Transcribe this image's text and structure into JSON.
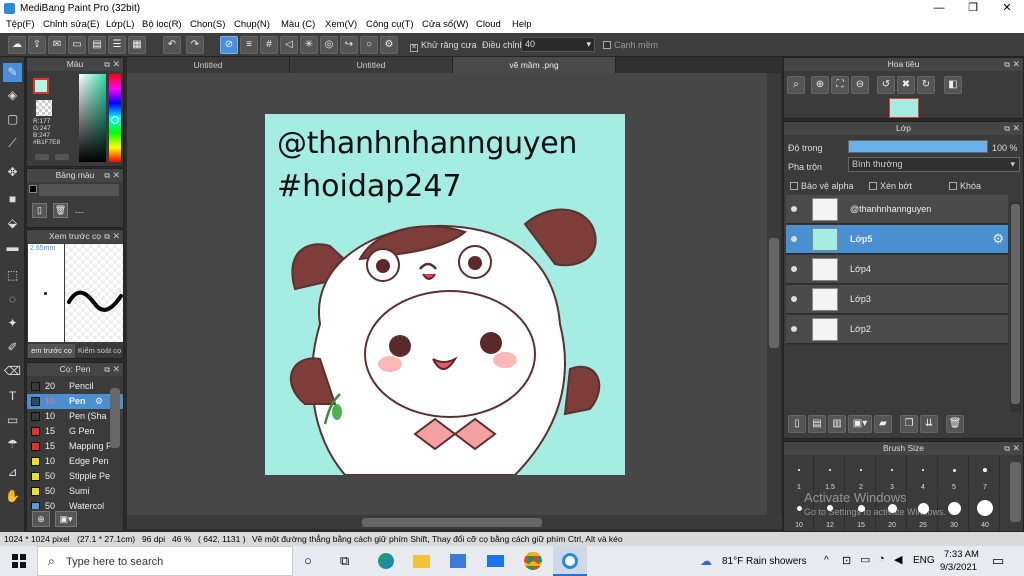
{
  "app": {
    "title": "MediBang Paint Pro (32bit)"
  },
  "menu": [
    "Tệp(F)",
    "Chỉnh sửa(E)",
    "Lớp(L)",
    "Bộ lọc(R)",
    "Chọn(S)",
    "Chụp(N)",
    "Màu (C)",
    "Xem(V)",
    "Công cụ(T)",
    "Cửa sổ(W)",
    "Cloud",
    "Help"
  ],
  "toolbar": {
    "antialias": "Khử răng cưa",
    "correction": "Điều chỉnh",
    "correction_value": "40",
    "edge": "Cạnh mềm"
  },
  "color_panel": {
    "title": "Màu",
    "r": "R:177",
    "g": "G:247",
    "b": "B:247",
    "hex": "#B1F7E8"
  },
  "palette_panel": {
    "title": "Bảng màu",
    "placeholder": "---"
  },
  "preview_panel": {
    "title": "Xem trước cọ",
    "size": "2.65mm",
    "tab1": "em trước cọ",
    "tab2": "Kiểm soát cọ"
  },
  "brush_panel": {
    "title": "Cọ: Pen",
    "items": [
      {
        "size": "20",
        "name": "Pencil",
        "color": "#3a3a3a"
      },
      {
        "size": "10",
        "name": "Pen",
        "color": "#2b4b6b",
        "selected": true
      },
      {
        "size": "10",
        "name": "Pen (Sha",
        "color": "#3a3a3a"
      },
      {
        "size": "15",
        "name": "G Pen",
        "color": "#e83030"
      },
      {
        "size": "15",
        "name": "Mapping P",
        "color": "#e83030"
      },
      {
        "size": "10",
        "name": "Edge Pen",
        "color": "#e8e020"
      },
      {
        "size": "50",
        "name": "Stipple Pe",
        "color": "#e8e020"
      },
      {
        "size": "50",
        "name": "Sumi",
        "color": "#e8e020"
      },
      {
        "size": "50",
        "name": "Watercol",
        "color": "#4aa0e0"
      }
    ]
  },
  "tabs": [
    "Untitled",
    "Untitled",
    "vẽ mầm .png"
  ],
  "canvas": {
    "line1": "@thanhnhannguyen",
    "line2": "#hoidap247",
    "bg": "#a5ece2"
  },
  "navigator": {
    "title": "Hoa tiêu"
  },
  "layer_panel": {
    "title": "Lớp",
    "opacity_label": "Độ trong",
    "opacity_value": "100 %",
    "opacity": 1.0,
    "blend_label": "Pha trộn",
    "blend_value": "Bình thường",
    "protect_alpha": "Bảo vệ alpha",
    "clipping": "Xén bớt",
    "lock": "Khóa",
    "layers": [
      {
        "name": "@thanhnhannguyen"
      },
      {
        "name": "Lớp5",
        "selected": true
      },
      {
        "name": "Lớp4"
      },
      {
        "name": "Lớp3"
      },
      {
        "name": "Lớp2"
      }
    ]
  },
  "brush_size": {
    "title": "Brush Size",
    "row1": [
      "1",
      "1.5",
      "2",
      "3",
      "4",
      "5",
      "7"
    ],
    "row2": [
      "10",
      "12",
      "15",
      "20",
      "25",
      "30",
      "40"
    ]
  },
  "watermark": {
    "line1": "Activate Windows",
    "line2": "Go to Settings to activate Windows."
  },
  "status": {
    "size": "1024 * 1024 pixel",
    "cm": "(27.1 * 27.1cm)",
    "dpi": "96 dpi",
    "zoom": "46 %",
    "coords": "( 642, 1131 )",
    "hint": "Vẽ một đường thẳng bằng cách giữ phím Shift, Thay đổi cỡ cọ bằng cách giữ phím Ctrl, Alt và kéo"
  },
  "taskbar": {
    "search": "Type here to search",
    "weather": "81°F  Rain showers",
    "lang": "ENG",
    "time": "7:33 AM",
    "date": "9/3/2021"
  }
}
